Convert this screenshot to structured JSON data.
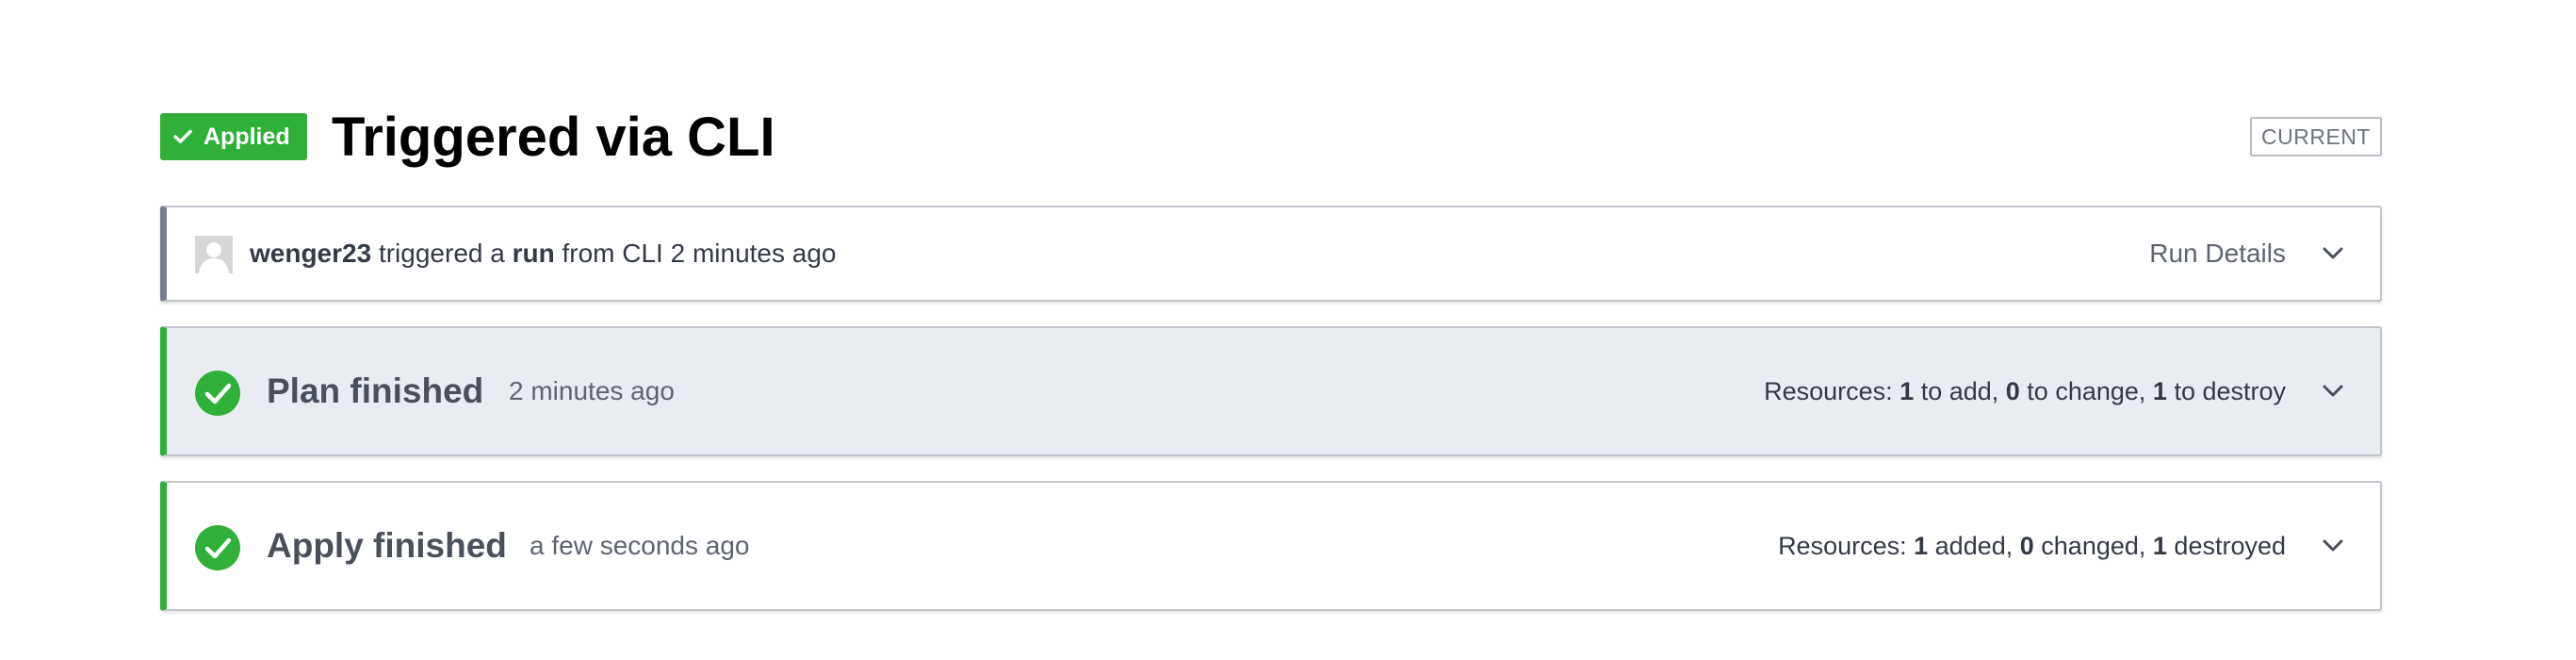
{
  "header": {
    "status_badge": "Applied",
    "title": "Triggered via CLI",
    "current_tag": "CURRENT"
  },
  "run": {
    "user": "wenger23",
    "text_triggered": " triggered a ",
    "run_word": "run",
    "text_from": " from CLI 2 minutes ago",
    "details_label": "Run Details"
  },
  "plan": {
    "title": "Plan finished",
    "time": "2 minutes ago",
    "resources_prefix": "Resources: ",
    "add_count": "1",
    "add_label": " to add, ",
    "change_count": "0",
    "change_label": " to change, ",
    "destroy_count": "1",
    "destroy_label": " to destroy"
  },
  "apply": {
    "title": "Apply finished",
    "time": "a few seconds ago",
    "resources_prefix": "Resources: ",
    "add_count": "1",
    "add_label": " added, ",
    "change_count": "0",
    "change_label": " changed, ",
    "destroy_count": "1",
    "destroy_label": " destroyed"
  },
  "colors": {
    "success_green": "#2eb039",
    "run_border": "#7a7e8f",
    "plan_bg": "#e9ecf1"
  },
  "icons": {
    "badge_icon": "check-icon",
    "status_icon": "check-circle-icon",
    "expand_icon": "chevron-down-icon",
    "avatar_icon": "user-avatar"
  }
}
